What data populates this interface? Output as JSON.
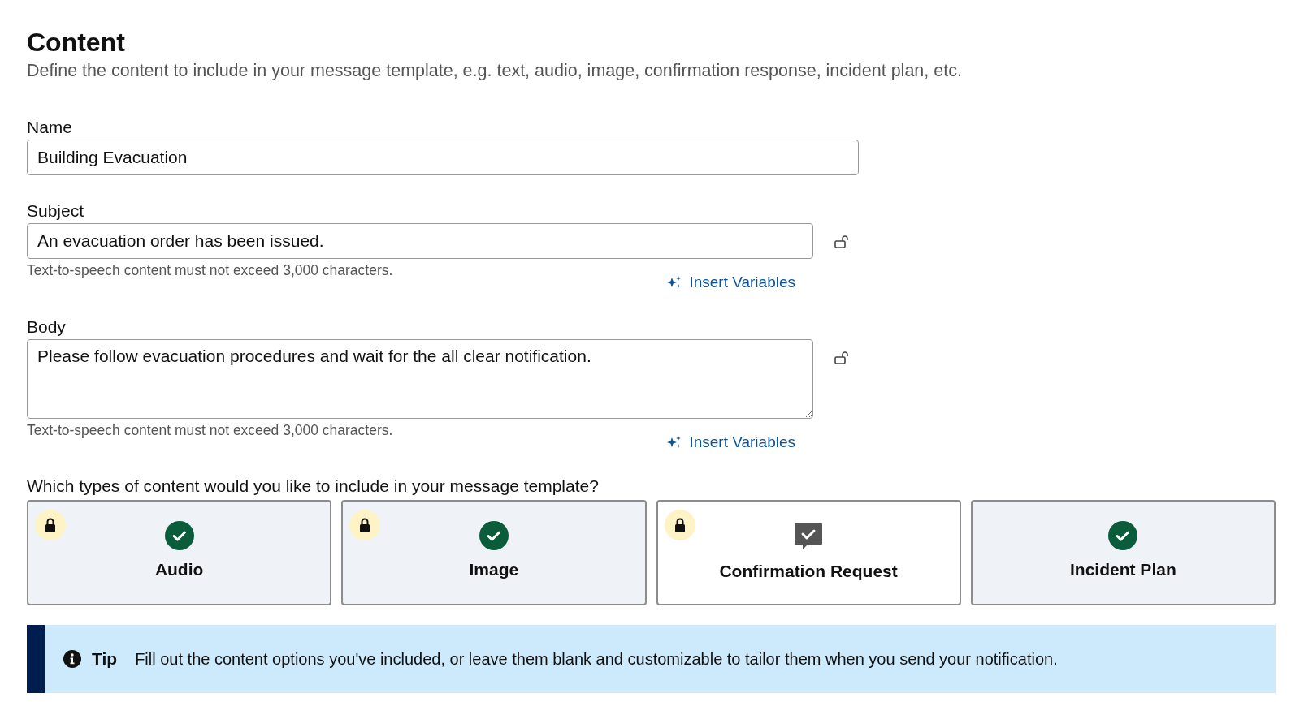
{
  "heading": {
    "title": "Content",
    "description": "Define the content to include in your message template, e.g. text, audio, image, confirmation response, incident plan, etc."
  },
  "fields": [
    {
      "kind": "input",
      "label": "Name",
      "value": "Building Evacuation"
    },
    {
      "kind": "input",
      "label": "Subject",
      "value": "An evacuation order has been issued.",
      "locked": false,
      "hint": "Text-to-speech content must not exceed 3,000 characters.",
      "link": "Insert Variables"
    },
    {
      "kind": "textarea",
      "label": "Body",
      "value": "Please follow evacuation procedures and wait for the all clear notification.",
      "locked": false,
      "hint": "Text-to-speech content must not exceed 3,000 characters.",
      "link": "Insert Variables"
    }
  ],
  "content_types": {
    "question": "Which types of content would you like to include in your message template?",
    "options": [
      {
        "label": "Audio",
        "selected": true,
        "locked": true
      },
      {
        "label": "Image",
        "selected": true,
        "locked": true
      },
      {
        "label": "Confirmation Request",
        "selected": false,
        "locked": true
      },
      {
        "label": "Incident Plan",
        "selected": true,
        "locked": false
      }
    ]
  },
  "tip": {
    "label": "Tip",
    "text": "Fill out the content options you've included, or leave them blank and customizable to tailor them when you send your notification."
  }
}
